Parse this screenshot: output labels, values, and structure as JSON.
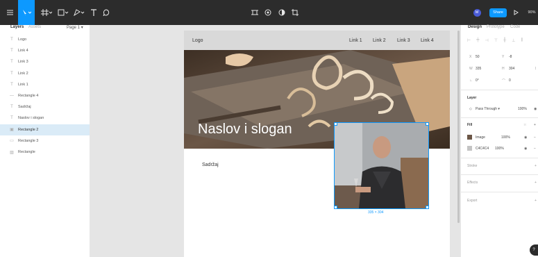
{
  "toolbar": {
    "user_initial": "M",
    "share_label": "Share",
    "zoom": "90%",
    "icons": [
      "menu-icon",
      "move-tool-icon",
      "frame-tool-icon",
      "shape-tool-icon",
      "pen-tool-icon",
      "text-tool-icon",
      "comment-icon"
    ],
    "center_icons": [
      "component-icon",
      "plugins-icon",
      "theme-icon",
      "crop-icon"
    ]
  },
  "left_panel": {
    "tabs": {
      "layers": "Layers",
      "assets": "Assets",
      "page": "Page 1"
    },
    "layers": [
      {
        "icon": "T",
        "name": "Logo"
      },
      {
        "icon": "T",
        "name": "Link 4"
      },
      {
        "icon": "T",
        "name": "Link 3"
      },
      {
        "icon": "T",
        "name": "Link 2"
      },
      {
        "icon": "T",
        "name": "Link 1"
      },
      {
        "icon": "—",
        "name": "Rectangle 4"
      },
      {
        "icon": "T",
        "name": "Sadržaj"
      },
      {
        "icon": "T",
        "name": "Naslov i slogan"
      },
      {
        "icon": "▣",
        "name": "Rectangle 2",
        "selected": true
      },
      {
        "icon": "▭",
        "name": "Rectangle 3"
      },
      {
        "icon": "▨",
        "name": "Rectangle"
      }
    ]
  },
  "canvas": {
    "logo": "Logo",
    "links": [
      "Link 1",
      "Link 2",
      "Link 3",
      "Link 4"
    ],
    "hero_title": "Naslov i slogan",
    "content_label": "Sadržaj",
    "selection_size": "335 × 304"
  },
  "right_panel": {
    "tabs": {
      "design": "Design",
      "prototype": "Prototype",
      "code": "Code"
    },
    "position": {
      "x_label": "X",
      "x": "50",
      "y_label": "Y",
      "y": "-8",
      "w_label": "W",
      "w": "335",
      "h_label": "H",
      "h": "304",
      "rotation": "0°",
      "radius": "0"
    },
    "layer_section": "Layer",
    "blend_mode": "Pass Through",
    "opacity": "100%",
    "fill_section": "Fill",
    "fills": [
      {
        "name": "Image",
        "opacity": "100%"
      },
      {
        "name": "C4C4C4",
        "opacity": "100%",
        "color": "#C4C4C4"
      }
    ],
    "stroke": "Stroke",
    "effects": "Effects",
    "export": "Export"
  },
  "colors": {
    "accent": "#0d99ff",
    "topbar": "#2c2c2c",
    "selection": "#daebf7"
  },
  "help_label": "?"
}
